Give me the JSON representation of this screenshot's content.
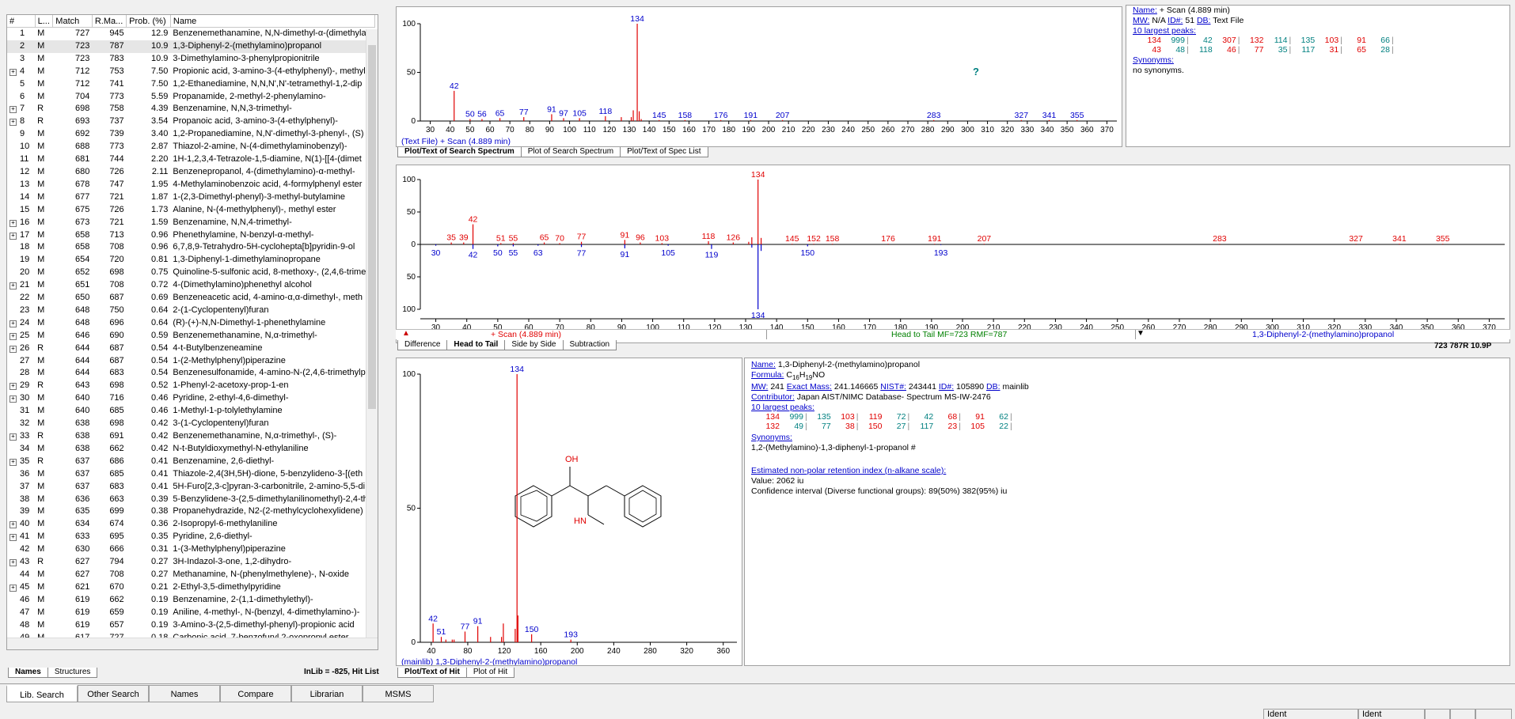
{
  "hitlist": {
    "columns": [
      "#",
      "L...",
      "Match",
      "R.Ma...",
      "Prob. (%)",
      "Name"
    ],
    "rows": [
      [
        "1",
        "M",
        "727",
        "945",
        "12.9",
        "Benzenemethanamine, N,N-dimethyl-α-(dimethyla",
        ""
      ],
      [
        "2",
        "M",
        "723",
        "787",
        "10.9",
        "1,3-Diphenyl-2-(methylamino)propanol",
        ""
      ],
      [
        "3",
        "M",
        "723",
        "783",
        "10.9",
        "3-Dimethylamino-3-phenylpropionitrile",
        ""
      ],
      [
        "4",
        "M",
        "712",
        "753",
        "7.50",
        "Propionic acid, 3-amino-3-(4-ethylphenyl)-, methyl",
        "+"
      ],
      [
        "5",
        "M",
        "712",
        "741",
        "7.50",
        "1,2-Ethanediamine, N,N,N',N'-tetramethyl-1,2-dip",
        ""
      ],
      [
        "6",
        "M",
        "704",
        "773",
        "5.59",
        "Propanamide, 2-methyl-2-phenylamino-",
        ""
      ],
      [
        "7",
        "R",
        "698",
        "758",
        "4.39",
        "Benzenamine, N,N,3-trimethyl-",
        "+"
      ],
      [
        "8",
        "R",
        "693",
        "737",
        "3.54",
        "Propanoic acid, 3-amino-3-(4-ethylphenyl)-",
        "+"
      ],
      [
        "9",
        "M",
        "692",
        "739",
        "3.40",
        "1,2-Propanediamine, N,N'-dimethyl-3-phenyl-, (S)",
        ""
      ],
      [
        "10",
        "M",
        "688",
        "773",
        "2.87",
        "Thiazol-2-amine, N-(4-dimethylaminobenzyl)-",
        ""
      ],
      [
        "11",
        "M",
        "681",
        "744",
        "2.20",
        "1H-1,2,3,4-Tetrazole-1,5-diamine, N(1)-[[4-(dimet",
        ""
      ],
      [
        "12",
        "M",
        "680",
        "726",
        "2.11",
        "Benzenepropanol, 4-(dimethylamino)-α-methyl-",
        ""
      ],
      [
        "13",
        "M",
        "678",
        "747",
        "1.95",
        "4-Methylaminobenzoic acid, 4-formylphenyl ester",
        ""
      ],
      [
        "14",
        "M",
        "677",
        "721",
        "1.87",
        "1-(2,3-Dimethyl-phenyl)-3-methyl-butylamine",
        ""
      ],
      [
        "15",
        "M",
        "675",
        "726",
        "1.73",
        "Alanine, N-(4-methylphenyl)-, methyl ester",
        ""
      ],
      [
        "16",
        "M",
        "673",
        "721",
        "1.59",
        "Benzenamine, N,N,4-trimethyl-",
        "+"
      ],
      [
        "17",
        "M",
        "658",
        "713",
        "0.96",
        "Phenethylamine, N-benzyl-α-methyl-",
        "+"
      ],
      [
        "18",
        "M",
        "658",
        "708",
        "0.96",
        "6,7,8,9-Tetrahydro-5H-cyclohepta[b]pyridin-9-ol",
        ""
      ],
      [
        "19",
        "M",
        "654",
        "720",
        "0.81",
        "1,3-Diphenyl-1-dimethylaminopropane",
        ""
      ],
      [
        "20",
        "M",
        "652",
        "698",
        "0.75",
        "Quinoline-5-sulfonic acid, 8-methoxy-, (2,4,6-trime",
        ""
      ],
      [
        "21",
        "M",
        "651",
        "708",
        "0.72",
        "4-(Dimethylamino)phenethyl alcohol",
        "+"
      ],
      [
        "22",
        "M",
        "650",
        "687",
        "0.69",
        "Benzeneacetic acid, 4-amino-α,α-dimethyl-, meth",
        ""
      ],
      [
        "23",
        "M",
        "648",
        "750",
        "0.64",
        "2-(1-Cyclopentenyl)furan",
        ""
      ],
      [
        "24",
        "M",
        "648",
        "696",
        "0.64",
        "(R)-(+)-N,N-Dimethyl-1-phenethylamine",
        "+"
      ],
      [
        "25",
        "M",
        "646",
        "690",
        "0.59",
        "Benzenemethanamine, N,α-trimethyl-",
        "+"
      ],
      [
        "26",
        "R",
        "644",
        "687",
        "0.54",
        "4-t-Butylbenzeneamine",
        "+"
      ],
      [
        "27",
        "M",
        "644",
        "687",
        "0.54",
        "1-(2-Methylphenyl)piperazine",
        ""
      ],
      [
        "28",
        "M",
        "644",
        "683",
        "0.54",
        "Benzenesulfonamide, 4-amino-N-(2,4,6-trimethylp",
        ""
      ],
      [
        "29",
        "R",
        "643",
        "698",
        "0.52",
        "1-Phenyl-2-acetoxy-prop-1-en",
        "+"
      ],
      [
        "30",
        "M",
        "640",
        "716",
        "0.46",
        "Pyridine, 2-ethyl-4,6-dimethyl-",
        "+"
      ],
      [
        "31",
        "M",
        "640",
        "685",
        "0.46",
        "1-Methyl-1-p-tolylethylamine",
        ""
      ],
      [
        "32",
        "M",
        "638",
        "698",
        "0.42",
        "3-(1-Cyclopentenyl)furan",
        ""
      ],
      [
        "33",
        "R",
        "638",
        "691",
        "0.42",
        "Benzenemethanamine, N,α-trimethyl-, (S)-",
        "+"
      ],
      [
        "34",
        "M",
        "638",
        "662",
        "0.42",
        "N-t-Butyldioxymethyl-N-ethylaniline",
        ""
      ],
      [
        "35",
        "R",
        "637",
        "686",
        "0.41",
        "Benzenamine, 2,6-diethyl-",
        "+"
      ],
      [
        "36",
        "M",
        "637",
        "685",
        "0.41",
        "Thiazole-2,4(3H,5H)-dione, 5-benzylideno-3-[(eth",
        ""
      ],
      [
        "37",
        "M",
        "637",
        "683",
        "0.41",
        "5H-Furo[2,3-c]pyran-3-carbonitrile, 2-amino-5,5-di",
        ""
      ],
      [
        "38",
        "M",
        "636",
        "663",
        "0.39",
        "5-Benzylidene-3-(2,5-dimethylanilinomethyl)-2,4-th",
        ""
      ],
      [
        "39",
        "M",
        "635",
        "699",
        "0.38",
        "Propanehydrazide, N2-(2-methylcyclohexylidene)",
        ""
      ],
      [
        "40",
        "M",
        "634",
        "674",
        "0.36",
        "2-Isopropyl-6-methylaniline",
        "+"
      ],
      [
        "41",
        "M",
        "633",
        "695",
        "0.35",
        "Pyridine, 2,6-diethyl-",
        "+"
      ],
      [
        "42",
        "M",
        "630",
        "666",
        "0.31",
        "1-(3-Methylphenyl)piperazine",
        ""
      ],
      [
        "43",
        "R",
        "627",
        "794",
        "0.27",
        "3H-Indazol-3-one, 1,2-dihydro-",
        "+"
      ],
      [
        "44",
        "M",
        "627",
        "708",
        "0.27",
        "Methanamine, N-(phenylmethylene)-, N-oxide",
        ""
      ],
      [
        "45",
        "M",
        "621",
        "670",
        "0.21",
        "2-Ethyl-3,5-dimethylpyridine",
        "+"
      ],
      [
        "46",
        "M",
        "619",
        "662",
        "0.19",
        "Benzenamine, 2-(1,1-dimethylethyl)-",
        ""
      ],
      [
        "47",
        "M",
        "619",
        "659",
        "0.19",
        "Aniline, 4-methyl-, N-(benzyl, 4-dimethylamino-)-",
        ""
      ],
      [
        "48",
        "M",
        "619",
        "657",
        "0.19",
        "3-Amino-3-(2,5-dimethyl-phenyl)-propionic acid",
        ""
      ],
      [
        "49",
        "M",
        "617",
        "727",
        "0.18",
        "Carbonic acid, 7-benzofuryl 2-oxopropyl ester",
        ""
      ]
    ],
    "tabs": [
      "Names",
      "Structures"
    ],
    "status": "InLib = -825, Hit List"
  },
  "search_spectrum": {
    "caption": "(Text File) + Scan (4.889 min)",
    "tabs": [
      "Plot/Text of Search Spectrum",
      "Plot of Search Spectrum",
      "Plot/Text of Spec List"
    ],
    "help_mark": "?"
  },
  "search_info": {
    "name_label": "Name:",
    "name_value": "+ Scan (4.889 min)",
    "mw_label": "MW:",
    "mw_value": "N/A",
    "id_label": "ID#:",
    "id_value": "51",
    "db_label": "DB:",
    "db_value": "Text File",
    "peaks_label": "10 largest peaks:",
    "peaks_row1": [
      [
        "134",
        "999"
      ],
      [
        "42",
        "307"
      ],
      [
        "132",
        "114"
      ],
      [
        "135",
        "103"
      ],
      [
        "91",
        "66"
      ]
    ],
    "peaks_row2": [
      [
        "43",
        "48"
      ],
      [
        "118",
        "46"
      ],
      [
        "77",
        "35"
      ],
      [
        "117",
        "31"
      ],
      [
        "65",
        "28"
      ]
    ],
    "synonyms_label": "Synonyms:",
    "synonyms_value": "no synonyms."
  },
  "head_to_tail": {
    "scan_label": "+ Scan (4.889 min)",
    "mf_label": "Head to Tail MF=723 RMF=787",
    "hit_name": "1,3-Diphenyl-2-(methylamino)propanol",
    "score": "723 787R 10.9P",
    "tabs": [
      "Difference",
      "Head to Tail",
      "Side by Side",
      "Subtraction"
    ]
  },
  "hit_spectrum": {
    "caption": "(mainlib) 1,3-Diphenyl-2-(methylamino)propanol",
    "tabs": [
      "Plot/Text of Hit",
      "Plot of Hit"
    ],
    "structure_oh": "OH",
    "structure_hn": "HN"
  },
  "hit_info": {
    "name_label": "Name:",
    "name_value": "1,3-Diphenyl-2-(methylamino)propanol",
    "formula_label": "Formula:",
    "formula_c": "C",
    "formula_c_n": "16",
    "formula_h": "H",
    "formula_h_n": "19",
    "formula_rest": "NO",
    "mw_label": "MW:",
    "mw_value": "241",
    "exact_label": "Exact Mass:",
    "exact_value": "241.146665",
    "nist_label": "NIST#:",
    "nist_value": "243441",
    "id_label": "ID#:",
    "id_value": "105890",
    "db_label": "DB:",
    "db_value": "mainlib",
    "contrib_label": "Contributor:",
    "contrib_value": "Japan AIST/NIMC Database- Spectrum MS-IW-2476",
    "peaks_label": "10 largest peaks:",
    "peaks_row1": [
      [
        "134",
        "999"
      ],
      [
        "135",
        "103"
      ],
      [
        "119",
        "72"
      ],
      [
        "42",
        "68"
      ],
      [
        "91",
        "62"
      ]
    ],
    "peaks_row2": [
      [
        "132",
        "49"
      ],
      [
        "77",
        "38"
      ],
      [
        "150",
        "27"
      ],
      [
        "117",
        "23"
      ],
      [
        "105",
        "22"
      ]
    ],
    "synonyms_label": "Synonyms:",
    "synonyms_value": "1,2-(Methylamino)-1,3-diphenyl-1-propanol  #",
    "ri_label": "Estimated non-polar retention index (n-alkane scale):",
    "ri_value": "Value: 2062 iu",
    "ri_ci": "Confidence interval (Diverse functional groups):  89(50%) 382(95%) iu"
  },
  "bottom_tabs": [
    "Lib. Search",
    "Other Search",
    "Names",
    "Compare",
    "Librarian",
    "MSMS"
  ],
  "status_bar": [
    "Ident",
    "Ident"
  ],
  "chart_data": [
    {
      "type": "bar",
      "title": "",
      "xlim": [
        25,
        375
      ],
      "ylim": [
        0,
        100
      ],
      "xticks": [
        30,
        40,
        50,
        60,
        70,
        80,
        90,
        100,
        110,
        120,
        130,
        140,
        150,
        160,
        170,
        180,
        190,
        200,
        210,
        220,
        230,
        240,
        250,
        260,
        270,
        280,
        290,
        300,
        310,
        320,
        330,
        340,
        350,
        360,
        370
      ],
      "yticks": [
        0,
        50,
        100
      ],
      "peaks": [
        [
          42,
          31
        ],
        [
          50,
          2
        ],
        [
          56,
          2
        ],
        [
          65,
          3
        ],
        [
          77,
          4
        ],
        [
          91,
          7
        ],
        [
          97,
          3
        ],
        [
          105,
          3
        ],
        [
          118,
          5
        ],
        [
          126,
          4
        ],
        [
          131,
          4
        ],
        [
          132,
          11
        ],
        [
          134,
          100
        ],
        [
          135,
          10
        ],
        [
          136,
          2
        ],
        [
          145,
          1
        ],
        [
          158,
          1
        ],
        [
          176,
          1
        ],
        [
          191,
          1
        ],
        [
          207,
          1
        ],
        [
          283,
          1
        ],
        [
          327,
          1
        ],
        [
          341,
          1
        ],
        [
          355,
          1
        ]
      ],
      "labels": [
        [
          42,
          "42"
        ],
        [
          50,
          "50"
        ],
        [
          56,
          "56"
        ],
        [
          65,
          "65"
        ],
        [
          77,
          "77"
        ],
        [
          91,
          "91"
        ],
        [
          97,
          "97"
        ],
        [
          105,
          "105"
        ],
        [
          118,
          "118"
        ],
        [
          134,
          "134"
        ],
        [
          145,
          "145"
        ],
        [
          158,
          "158"
        ],
        [
          176,
          "176"
        ],
        [
          191,
          "191"
        ],
        [
          207,
          "207"
        ],
        [
          283,
          "283"
        ],
        [
          327,
          "327"
        ],
        [
          341,
          "341"
        ],
        [
          355,
          "355"
        ]
      ]
    },
    {
      "type": "bar",
      "title": "",
      "xlim": [
        25,
        375
      ],
      "ylim": [
        -100,
        100
      ],
      "xticks": [
        30,
        40,
        50,
        60,
        70,
        80,
        90,
        100,
        110,
        120,
        130,
        140,
        150,
        160,
        170,
        180,
        190,
        200,
        210,
        220,
        230,
        240,
        250,
        260,
        270,
        280,
        290,
        300,
        310,
        320,
        330,
        340,
        350,
        360,
        370
      ],
      "yticks": [
        100,
        50,
        0,
        50,
        100
      ],
      "head": [
        [
          35,
          3
        ],
        [
          39,
          3
        ],
        [
          42,
          31
        ],
        [
          51,
          2
        ],
        [
          55,
          2
        ],
        [
          65,
          3
        ],
        [
          70,
          2
        ],
        [
          77,
          4
        ],
        [
          91,
          7
        ],
        [
          96,
          3
        ],
        [
          103,
          2
        ],
        [
          118,
          5
        ],
        [
          126,
          3
        ],
        [
          131,
          4
        ],
        [
          132,
          11
        ],
        [
          134,
          100
        ],
        [
          135,
          10
        ],
        [
          145,
          1
        ],
        [
          152,
          1
        ],
        [
          158,
          1
        ],
        [
          176,
          1
        ],
        [
          191,
          1
        ],
        [
          207,
          1
        ],
        [
          283,
          1
        ],
        [
          327,
          1
        ],
        [
          341,
          1
        ],
        [
          355,
          1
        ]
      ],
      "head_labels": [
        [
          35,
          "35"
        ],
        [
          39,
          "39"
        ],
        [
          42,
          "42"
        ],
        [
          51,
          "51"
        ],
        [
          55,
          "55"
        ],
        [
          65,
          "65"
        ],
        [
          70,
          "70"
        ],
        [
          77,
          "77"
        ],
        [
          91,
          "91"
        ],
        [
          96,
          "96"
        ],
        [
          103,
          "103"
        ],
        [
          118,
          "118"
        ],
        [
          126,
          "126"
        ],
        [
          134,
          "134"
        ],
        [
          145,
          "145"
        ],
        [
          152,
          "152"
        ],
        [
          158,
          "158"
        ],
        [
          176,
          "176"
        ],
        [
          191,
          "191"
        ],
        [
          207,
          "207"
        ],
        [
          283,
          "283"
        ],
        [
          327,
          "327"
        ],
        [
          341,
          "341"
        ],
        [
          355,
          "355"
        ]
      ],
      "tail": [
        [
          30,
          2
        ],
        [
          42,
          7
        ],
        [
          50,
          3
        ],
        [
          55,
          3
        ],
        [
          63,
          2
        ],
        [
          77,
          4
        ],
        [
          91,
          6
        ],
        [
          105,
          2
        ],
        [
          119,
          7
        ],
        [
          132,
          5
        ],
        [
          134,
          100
        ],
        [
          135,
          10
        ],
        [
          150,
          3
        ],
        [
          193,
          1
        ]
      ],
      "tail_labels": [
        [
          30,
          "30"
        ],
        [
          42,
          "42"
        ],
        [
          50,
          "50"
        ],
        [
          55,
          "55"
        ],
        [
          63,
          "63"
        ],
        [
          77,
          "77"
        ],
        [
          91,
          "91"
        ],
        [
          105,
          "105"
        ],
        [
          119,
          "119"
        ],
        [
          134,
          "134"
        ],
        [
          150,
          "150"
        ],
        [
          193,
          "193"
        ]
      ]
    },
    {
      "type": "bar",
      "title": "",
      "xlim": [
        28,
        375
      ],
      "ylim": [
        0,
        100
      ],
      "xticks": [
        40,
        80,
        120,
        160,
        200,
        240,
        280,
        320,
        360
      ],
      "yticks": [
        0,
        50,
        100
      ],
      "peaks": [
        [
          42,
          7
        ],
        [
          51,
          2
        ],
        [
          56,
          1
        ],
        [
          63,
          1
        ],
        [
          65,
          1
        ],
        [
          77,
          4
        ],
        [
          91,
          6
        ],
        [
          105,
          2
        ],
        [
          117,
          2
        ],
        [
          119,
          7
        ],
        [
          132,
          5
        ],
        [
          134,
          100
        ],
        [
          135,
          10
        ],
        [
          150,
          3
        ],
        [
          193,
          1
        ]
      ],
      "labels": [
        [
          42,
          "42"
        ],
        [
          51,
          "51"
        ],
        [
          77,
          "77"
        ],
        [
          91,
          "91"
        ],
        [
          134,
          "134"
        ],
        [
          150,
          "150"
        ],
        [
          193,
          "193"
        ]
      ]
    }
  ]
}
